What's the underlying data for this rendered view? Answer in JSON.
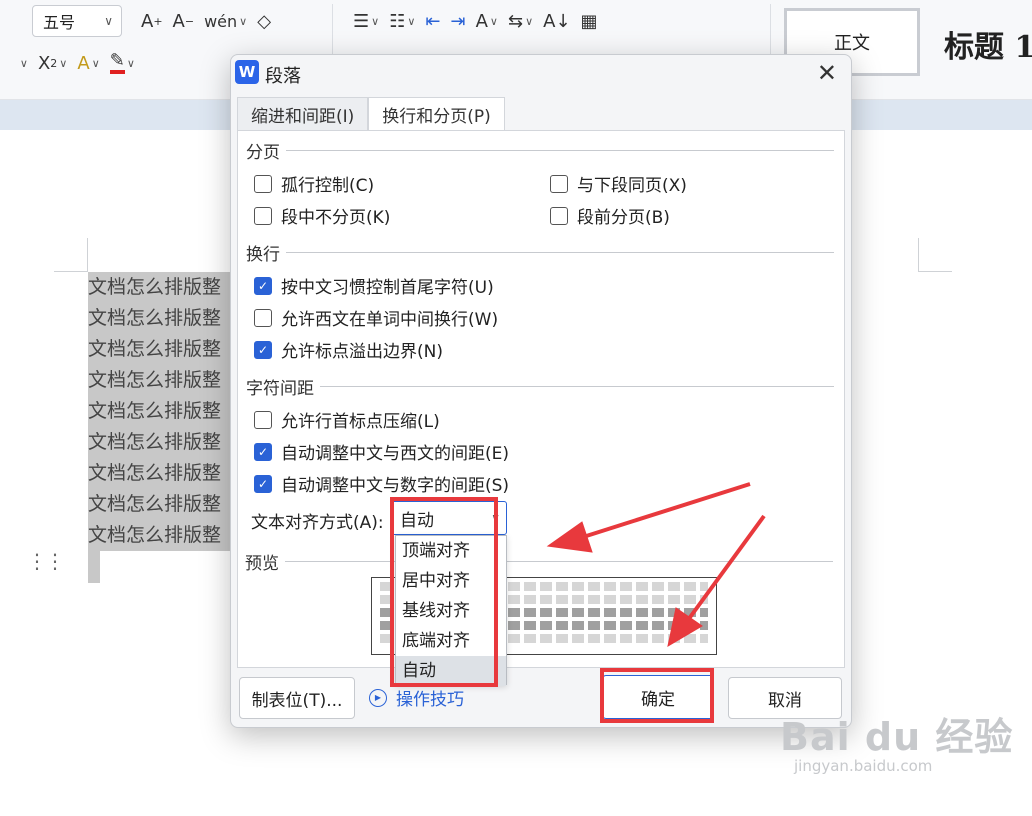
{
  "toolbar": {
    "font_size": "五号",
    "style_normal": "正文",
    "style_heading": "标题 1",
    "icons": [
      "increase-font-icon",
      "decrease-font-icon",
      "pinyin-icon",
      "eraser-icon",
      "bullet-list-icon",
      "number-list-icon",
      "decrease-indent-icon",
      "increase-indent-icon",
      "char-scale-icon",
      "line-spacing-icon",
      "sort-icon",
      "table-grid-icon",
      "superscript-icon",
      "font-color-icon",
      "highlight-icon"
    ]
  },
  "document": {
    "line_text": "文档怎么排版整",
    "line_count": 9
  },
  "dialog": {
    "title": "段落",
    "app_icon": "W",
    "tabs": [
      {
        "label": "缩进和间距(I)",
        "active": false
      },
      {
        "label": "换行和分页(P)",
        "active": true
      }
    ],
    "sections": {
      "pagination": "分页",
      "line_break": "换行",
      "char_spacing": "字符间距",
      "preview": "预览"
    },
    "options": {
      "widow_control": {
        "label": "孤行控制(C)",
        "checked": false
      },
      "keep_with_next": {
        "label": "与下段同页(X)",
        "checked": false
      },
      "keep_lines": {
        "label": "段中不分页(K)",
        "checked": false
      },
      "page_break_before": {
        "label": "段前分页(B)",
        "checked": false
      },
      "cjk_line_break": {
        "label": "按中文习惯控制首尾字符(U)",
        "checked": true
      },
      "western_word_wrap": {
        "label": "允许西文在单词中间换行(W)",
        "checked": false
      },
      "hanging_punct": {
        "label": "允许标点溢出边界(N)",
        "checked": true
      },
      "compress_punct": {
        "label": "允许行首标点压缩(L)",
        "checked": false
      },
      "auto_space_western": {
        "label": "自动调整中文与西文的间距(E)",
        "checked": true
      },
      "auto_space_number": {
        "label": "自动调整中文与数字的间距(S)",
        "checked": true
      }
    },
    "text_align": {
      "label": "文本对齐方式(A):",
      "value": "自动",
      "options": [
        "顶端对齐",
        "居中对齐",
        "基线对齐",
        "底端对齐",
        "自动"
      ]
    },
    "buttons": {
      "tabs_button": "制表位(T)...",
      "tips": "操作技巧",
      "ok": "确定",
      "cancel": "取消"
    }
  },
  "watermark": {
    "main": "Bai du 经验",
    "sub": "jingyan.baidu.com"
  },
  "colors": {
    "accent": "#2a62d6",
    "annotation": "#e8393d"
  }
}
